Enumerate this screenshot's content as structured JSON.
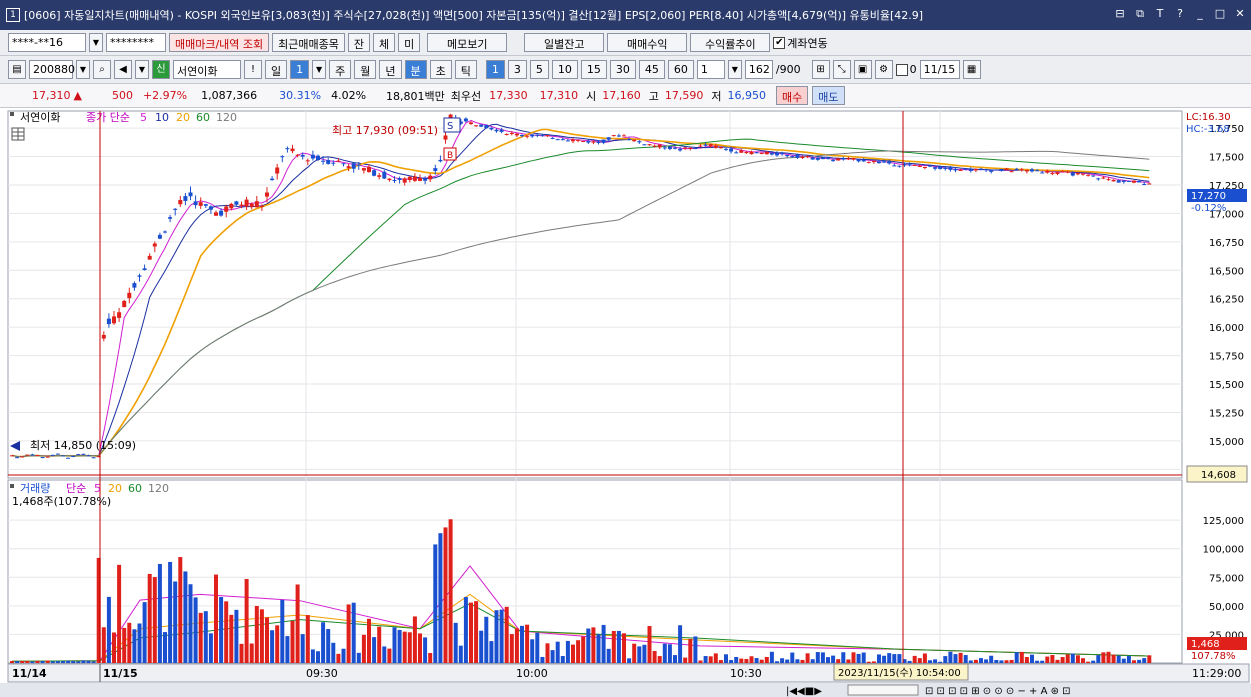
{
  "window": {
    "icon_label": "1",
    "title": "[0606] 자동일지차트(매매내역) - KOSPI 외국인보유[3,083(천)] 주식수[27,028(천)] 액면[500] 자본금[135(억)] 결산[12월] EPS[2,060] PER[8.40] 시가총액[4,679(억)] 유통비율[42.9]",
    "buttons": [
      "⊟",
      "⧉",
      "T",
      "?",
      "_",
      "□",
      "✕"
    ]
  },
  "toolbar1": {
    "account": "****-**16",
    "password": "********",
    "trade_mark_btn": "매매마크/내역 조회",
    "recent_btn": "최근매매종목",
    "tab_jan": "잔",
    "tab_che": "체",
    "tab_mi": "미",
    "memo_btn": "메모보기",
    "daily_btn": "일별잔고",
    "profit_btn": "매매수익",
    "rate_btn": "수익률추이",
    "link_label": "계좌연동",
    "link_checked": "✔"
  },
  "toolbar2": {
    "code": "200880",
    "badge": "신",
    "name": "서연이화",
    "period_tabs": [
      "일",
      "1",
      "주",
      "월",
      "년",
      "분",
      "초",
      "틱"
    ],
    "minute_tabs": [
      "1",
      "3",
      "5",
      "10",
      "15",
      "30",
      "45",
      "60"
    ],
    "unit": "1",
    "count": "162",
    "count_total": "/900",
    "checkbox_d_label": "0",
    "date": "11/15"
  },
  "quote": {
    "price": "17,310",
    "arrow": "▲",
    "change": "500",
    "pct": "+2.97%",
    "volume": "1,087,366",
    "vol_pct": "30.31%",
    "turnover": "4.02%",
    "amount": "18,801백만",
    "best_label": "최우선",
    "ask": "17,330",
    "bid": "17,310",
    "open_label": "시",
    "open": "17,160",
    "high_label": "고",
    "high": "17,590",
    "low_label": "저",
    "low": "16,950",
    "buy_btn": "매수",
    "sell_btn": "매도"
  },
  "colors": {
    "up": "#e0201a",
    "down": "#1a4fd0",
    "ma5": "#d21ed2",
    "ma10": "#1a2fa0",
    "ma20": "#f0a000",
    "ma60": "#1a8a2a",
    "ma120": "#7a7a7a",
    "cursor": "#c00000"
  },
  "chart": {
    "stock_label": "서연이화",
    "legend_title": "종가 단순",
    "legend_periods": [
      "5",
      "10",
      "20",
      "60",
      "120"
    ],
    "high_note": "최고 17,930 (09:51)",
    "low_note": "최저 14,850 (15:09)",
    "s_marker": "S",
    "b_marker": "B",
    "lc_label": "LC:16.30",
    "hc_label": "HC:-3.68",
    "last_price": "17,270",
    "last_pct": "-0.12%",
    "cursor_price": "14,608",
    "price_ticks": [
      "17,750",
      "17,500",
      "17,250",
      "17,000",
      "16,750",
      "16,500",
      "16,250",
      "16,000",
      "15,750",
      "15,500",
      "15,250",
      "15,000",
      "14,750"
    ],
    "volume_title": "거래량",
    "volume_legend_title": "단순",
    "volume_legend_periods": [
      "5",
      "20",
      "60",
      "120"
    ],
    "volume_info": "1,468주(107.78%)",
    "volume_ticks": [
      "125,000",
      "100,000",
      "75,000",
      "50,000",
      "25,000"
    ],
    "volume_last": "1,468",
    "volume_last_pct": "107.78%",
    "time_labels": [
      "11/14",
      "11/15",
      "09:30",
      "10:00",
      "10:30"
    ],
    "time_end": "11:29:00",
    "cursor_time": "2023/11/15(수) 10:54:00"
  },
  "chart_data": {
    "type": "candlestick",
    "price_axis": [
      14700,
      17900
    ],
    "volume_axis": [
      0,
      140000
    ],
    "high": 17930,
    "low": 14850,
    "last": 17270,
    "volume_last": 1468
  }
}
